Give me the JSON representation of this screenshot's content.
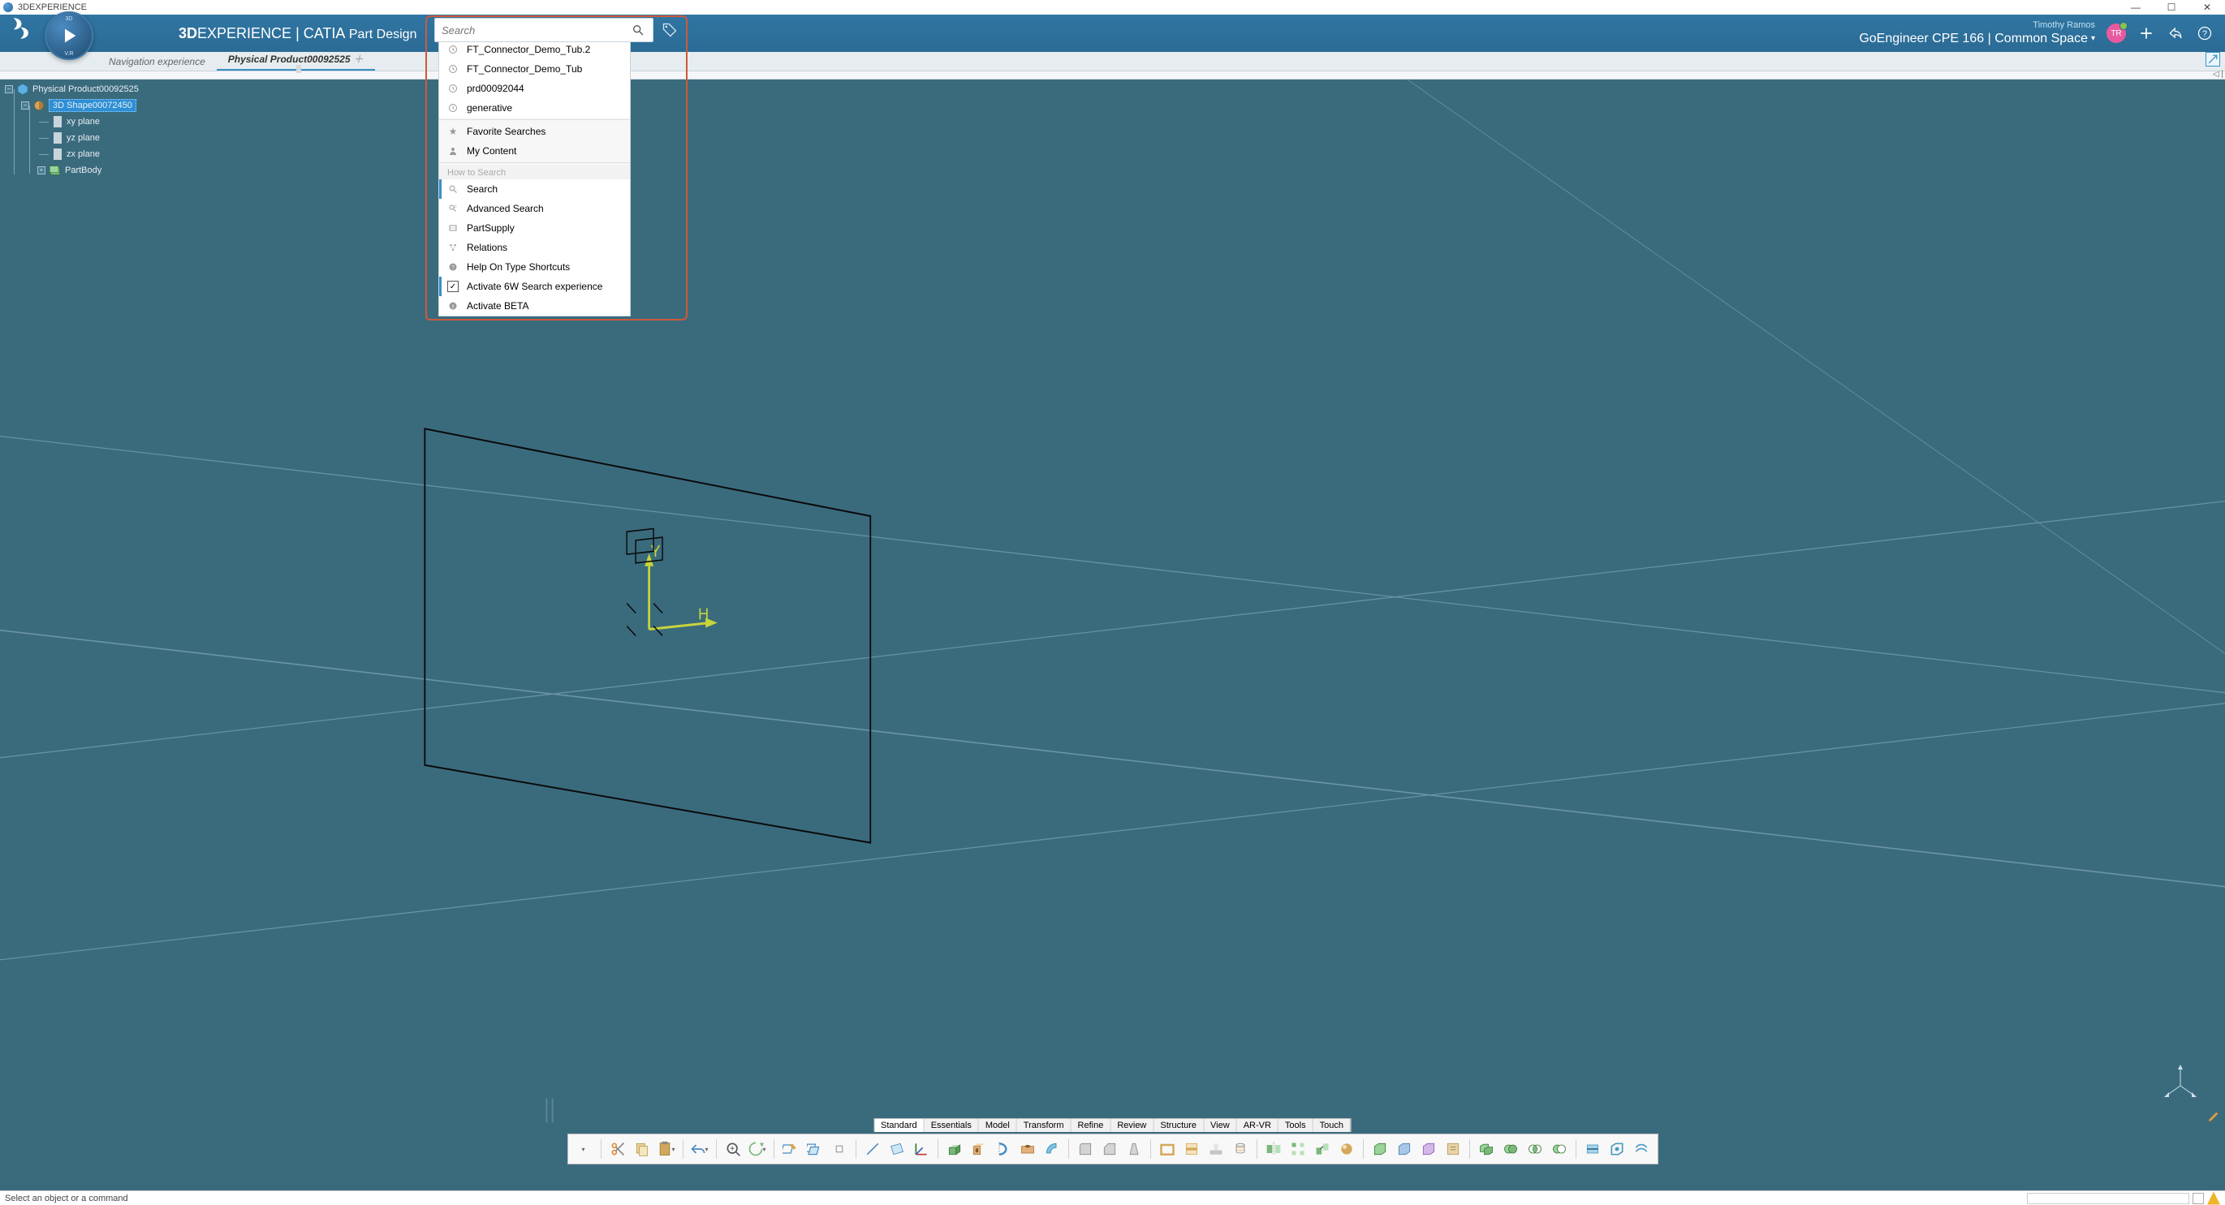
{
  "titlebar": {
    "app": "3DEXPERIENCE"
  },
  "compass": {
    "n": "3D",
    "s": "V.R",
    "w": "",
    "e": ""
  },
  "topbar": {
    "brand_bold": "3D",
    "brand_rest": "EXPERIENCE",
    "divider": " | ",
    "app_bold": "CATIA",
    "app_rest": " Part Design"
  },
  "user": {
    "name": "Timothy Ramos",
    "context": "GoEngineer CPE 166 | Common Space",
    "initials": "TR"
  },
  "search": {
    "placeholder": "Search",
    "history": [
      "FT_Connector_Demo_Tub.2",
      "FT_Connector_Demo_Tub",
      "prd00092044",
      "generative"
    ],
    "quick": [
      "Favorite Searches",
      "My Content"
    ],
    "howto_header": "How to Search",
    "howto": [
      "Search",
      "Advanced Search",
      "PartSupply",
      "Relations",
      "Help On Type Shortcuts",
      "Activate 6W Search experience",
      "Activate BETA"
    ]
  },
  "tabs": {
    "nav": "Navigation experience",
    "active": "Physical Product00092525"
  },
  "tree": {
    "root": "Physical Product00092525",
    "shape": "3D Shape00072450",
    "items": [
      "xy plane",
      "yz plane",
      "zx plane",
      "PartBody"
    ]
  },
  "axes": {
    "y": "Y",
    "h": "H"
  },
  "tool_tabs": [
    "Standard",
    "Essentials",
    "Model",
    "Transform",
    "Refine",
    "Review",
    "Structure",
    "View",
    "AR-VR",
    "Tools",
    "Touch"
  ],
  "status": "Select an object or a command"
}
